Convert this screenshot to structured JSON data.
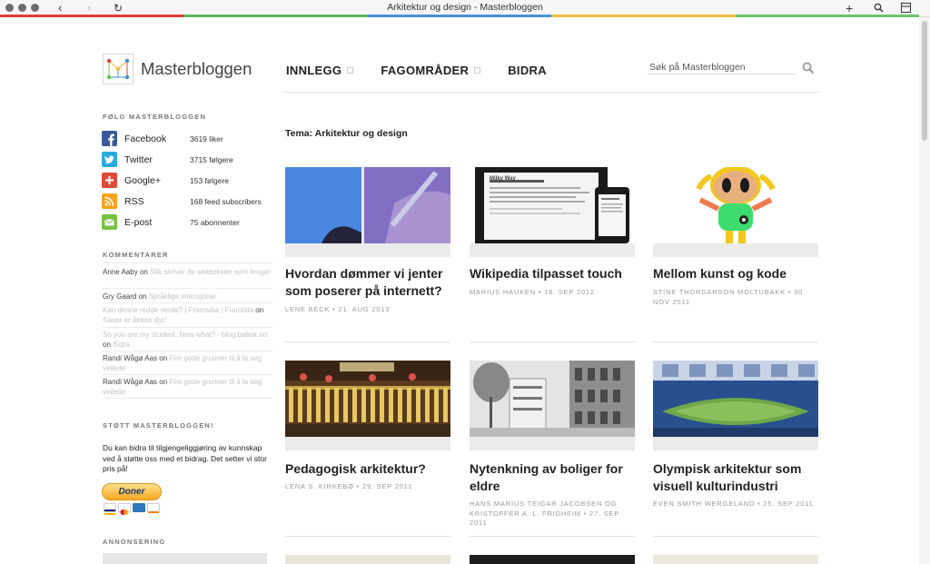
{
  "browser": {
    "title": "Arkitektur og design - Masterbloggen",
    "back": "‹",
    "forward": "›",
    "reload": "↻",
    "new_tab": "+",
    "colors": [
      "#e33b3b",
      "#5cb85c",
      "#4a90d9",
      "#f0c040",
      "#6cc36c"
    ]
  },
  "site": {
    "logo_text": "Masterbloggen",
    "nav": [
      {
        "label": "INNLEGG",
        "expandable": true
      },
      {
        "label": "FAGOMRÅDER",
        "expandable": true
      },
      {
        "label": "BIDRA",
        "expandable": false
      }
    ],
    "search_placeholder": "Søk på Masterbloggen"
  },
  "sidebar": {
    "follow_heading": "FØLG MASTERBLOGGEN",
    "follow": [
      {
        "name": "Facebook",
        "count": "3619 liker",
        "icon": "facebook-icon",
        "color": "#3b5998"
      },
      {
        "name": "Twitter",
        "count": "3715 følgere",
        "icon": "twitter-icon",
        "color": "#2aa9e0"
      },
      {
        "name": "Google+",
        "count": "153 følgere",
        "icon": "google-plus-icon",
        "color": "#dd4b39"
      },
      {
        "name": "RSS",
        "count": "168 feed subscribers",
        "icon": "rss-icon",
        "color": "#f7a21b"
      },
      {
        "name": "E-post",
        "count": "75 abonnenter",
        "icon": "email-icon",
        "color": "#7ac143"
      }
    ],
    "comments_heading": "KOMMENTARER",
    "comments": [
      {
        "author": "Anne Aaby",
        "on": "on",
        "post": "Slik skriver du webtekster som fenger"
      },
      {
        "author": "Gry Gaard",
        "on": "on",
        "post": "Språklige intensjoner"
      },
      {
        "author": "Kan denne redde verda? | Framsida | Framtida",
        "on": "on",
        "post": "Sauer er ålreite dyr!"
      },
      {
        "author": "So you are my student. Now what? - blog.babak.no",
        "on": "on",
        "post": "Bidra"
      },
      {
        "author": "Randi Wågø Aas",
        "on": "on",
        "post": "Fire gode grunner til å la seg veilede"
      },
      {
        "author": "Randi Wågø Aas",
        "on": "on",
        "post": "Fire gode grunner til å la seg veilede"
      }
    ],
    "support_heading": "STØTT MASTERBLOGGEN!",
    "support_text": "Du kan bidra til tilgjengeliggjøring av kunnskap ved å støtte oss med et bidrag. Det setter vi stor pris på!",
    "donate_label": "Doner",
    "ad_heading": "ANNONSERING"
  },
  "main": {
    "page_title": "Tema: Arkitektur og design",
    "posts": [
      {
        "title": "Hvordan dømmer vi jenter som poserer på internett?",
        "meta": "LENE BECK • 21. AUG 2013"
      },
      {
        "title": "Wikipedia tilpasset touch",
        "meta": "MARIUS HAUKEN • 18. SEP 2012"
      },
      {
        "title": "Mellom kunst og kode",
        "meta": "STINE THORDARSON MOLTUBAKK • 30. NOV 2011"
      },
      {
        "title": "Pedagogisk arkitektur?",
        "meta": "LENA S. KIRKEBØ • 29. SEP 2011"
      },
      {
        "title": "Nytenkning av boliger for eldre",
        "meta": "HANS MARIUS TEIGAR JACOBSEN OG KRISTOFFER A. L. FRIDHEIM • 27. SEP 2011"
      },
      {
        "title": "Olympisk arkitektur som visuell kulturindustri",
        "meta": "EVEN SMITH WERGELAND • 25. SEP 2011"
      }
    ],
    "tablet_heading": "Milky Way"
  }
}
